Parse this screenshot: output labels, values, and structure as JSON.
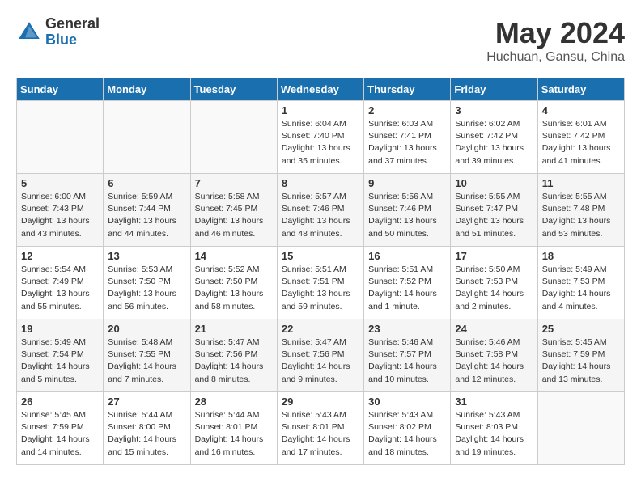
{
  "header": {
    "logo_general": "General",
    "logo_blue": "Blue",
    "title": "May 2024",
    "location": "Huchuan, Gansu, China"
  },
  "days_of_week": [
    "Sunday",
    "Monday",
    "Tuesday",
    "Wednesday",
    "Thursday",
    "Friday",
    "Saturday"
  ],
  "weeks": [
    [
      {
        "day": "",
        "info": ""
      },
      {
        "day": "",
        "info": ""
      },
      {
        "day": "",
        "info": ""
      },
      {
        "day": "1",
        "info": "Sunrise: 6:04 AM\nSunset: 7:40 PM\nDaylight: 13 hours\nand 35 minutes."
      },
      {
        "day": "2",
        "info": "Sunrise: 6:03 AM\nSunset: 7:41 PM\nDaylight: 13 hours\nand 37 minutes."
      },
      {
        "day": "3",
        "info": "Sunrise: 6:02 AM\nSunset: 7:42 PM\nDaylight: 13 hours\nand 39 minutes."
      },
      {
        "day": "4",
        "info": "Sunrise: 6:01 AM\nSunset: 7:42 PM\nDaylight: 13 hours\nand 41 minutes."
      }
    ],
    [
      {
        "day": "5",
        "info": "Sunrise: 6:00 AM\nSunset: 7:43 PM\nDaylight: 13 hours\nand 43 minutes."
      },
      {
        "day": "6",
        "info": "Sunrise: 5:59 AM\nSunset: 7:44 PM\nDaylight: 13 hours\nand 44 minutes."
      },
      {
        "day": "7",
        "info": "Sunrise: 5:58 AM\nSunset: 7:45 PM\nDaylight: 13 hours\nand 46 minutes."
      },
      {
        "day": "8",
        "info": "Sunrise: 5:57 AM\nSunset: 7:46 PM\nDaylight: 13 hours\nand 48 minutes."
      },
      {
        "day": "9",
        "info": "Sunrise: 5:56 AM\nSunset: 7:46 PM\nDaylight: 13 hours\nand 50 minutes."
      },
      {
        "day": "10",
        "info": "Sunrise: 5:55 AM\nSunset: 7:47 PM\nDaylight: 13 hours\nand 51 minutes."
      },
      {
        "day": "11",
        "info": "Sunrise: 5:55 AM\nSunset: 7:48 PM\nDaylight: 13 hours\nand 53 minutes."
      }
    ],
    [
      {
        "day": "12",
        "info": "Sunrise: 5:54 AM\nSunset: 7:49 PM\nDaylight: 13 hours\nand 55 minutes."
      },
      {
        "day": "13",
        "info": "Sunrise: 5:53 AM\nSunset: 7:50 PM\nDaylight: 13 hours\nand 56 minutes."
      },
      {
        "day": "14",
        "info": "Sunrise: 5:52 AM\nSunset: 7:50 PM\nDaylight: 13 hours\nand 58 minutes."
      },
      {
        "day": "15",
        "info": "Sunrise: 5:51 AM\nSunset: 7:51 PM\nDaylight: 13 hours\nand 59 minutes."
      },
      {
        "day": "16",
        "info": "Sunrise: 5:51 AM\nSunset: 7:52 PM\nDaylight: 14 hours\nand 1 minute."
      },
      {
        "day": "17",
        "info": "Sunrise: 5:50 AM\nSunset: 7:53 PM\nDaylight: 14 hours\nand 2 minutes."
      },
      {
        "day": "18",
        "info": "Sunrise: 5:49 AM\nSunset: 7:53 PM\nDaylight: 14 hours\nand 4 minutes."
      }
    ],
    [
      {
        "day": "19",
        "info": "Sunrise: 5:49 AM\nSunset: 7:54 PM\nDaylight: 14 hours\nand 5 minutes."
      },
      {
        "day": "20",
        "info": "Sunrise: 5:48 AM\nSunset: 7:55 PM\nDaylight: 14 hours\nand 7 minutes."
      },
      {
        "day": "21",
        "info": "Sunrise: 5:47 AM\nSunset: 7:56 PM\nDaylight: 14 hours\nand 8 minutes."
      },
      {
        "day": "22",
        "info": "Sunrise: 5:47 AM\nSunset: 7:56 PM\nDaylight: 14 hours\nand 9 minutes."
      },
      {
        "day": "23",
        "info": "Sunrise: 5:46 AM\nSunset: 7:57 PM\nDaylight: 14 hours\nand 10 minutes."
      },
      {
        "day": "24",
        "info": "Sunrise: 5:46 AM\nSunset: 7:58 PM\nDaylight: 14 hours\nand 12 minutes."
      },
      {
        "day": "25",
        "info": "Sunrise: 5:45 AM\nSunset: 7:59 PM\nDaylight: 14 hours\nand 13 minutes."
      }
    ],
    [
      {
        "day": "26",
        "info": "Sunrise: 5:45 AM\nSunset: 7:59 PM\nDaylight: 14 hours\nand 14 minutes."
      },
      {
        "day": "27",
        "info": "Sunrise: 5:44 AM\nSunset: 8:00 PM\nDaylight: 14 hours\nand 15 minutes."
      },
      {
        "day": "28",
        "info": "Sunrise: 5:44 AM\nSunset: 8:01 PM\nDaylight: 14 hours\nand 16 minutes."
      },
      {
        "day": "29",
        "info": "Sunrise: 5:43 AM\nSunset: 8:01 PM\nDaylight: 14 hours\nand 17 minutes."
      },
      {
        "day": "30",
        "info": "Sunrise: 5:43 AM\nSunset: 8:02 PM\nDaylight: 14 hours\nand 18 minutes."
      },
      {
        "day": "31",
        "info": "Sunrise: 5:43 AM\nSunset: 8:03 PM\nDaylight: 14 hours\nand 19 minutes."
      },
      {
        "day": "",
        "info": ""
      }
    ]
  ]
}
